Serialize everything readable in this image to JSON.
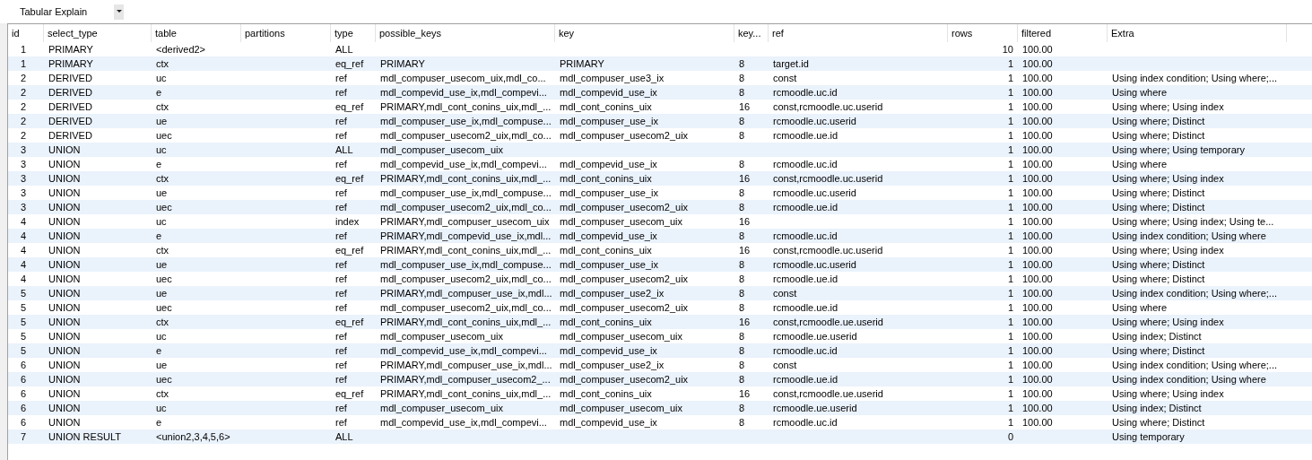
{
  "view_selector": {
    "value": "Tabular Explain"
  },
  "table": {
    "columns": [
      "id",
      "select_type",
      "table",
      "partitions",
      "type",
      "possible_keys",
      "key",
      "key...",
      "ref",
      "rows",
      "filtered",
      "Extra"
    ],
    "rows": [
      {
        "id": "1",
        "select_type": "PRIMARY",
        "table": "<derived2>",
        "type": "ALL",
        "rows": "10",
        "filtered": "100.00"
      },
      {
        "id": "1",
        "select_type": "PRIMARY",
        "table": "ctx",
        "type": "eq_ref",
        "possible_keys": "PRIMARY",
        "key": "PRIMARY",
        "key_len": "8",
        "ref": "target.id",
        "rows": "1",
        "filtered": "100.00"
      },
      {
        "id": "2",
        "select_type": "DERIVED",
        "table": "uc",
        "type": "ref",
        "possible_keys": "mdl_compuser_usecom_uix,mdl_co...",
        "key": "mdl_compuser_use3_ix",
        "key_len": "8",
        "ref": "const",
        "rows": "1",
        "filtered": "100.00",
        "extra": "Using index condition; Using where;..."
      },
      {
        "id": "2",
        "select_type": "DERIVED",
        "table": "e",
        "type": "ref",
        "possible_keys": "mdl_compevid_use_ix,mdl_compevi...",
        "key": "mdl_compevid_use_ix",
        "key_len": "8",
        "ref": "rcmoodle.uc.id",
        "rows": "1",
        "filtered": "100.00",
        "extra": "Using where"
      },
      {
        "id": "2",
        "select_type": "DERIVED",
        "table": "ctx",
        "type": "eq_ref",
        "possible_keys": "PRIMARY,mdl_cont_conins_uix,mdl_...",
        "key": "mdl_cont_conins_uix",
        "key_len": "16",
        "ref": "const,rcmoodle.uc.userid",
        "rows": "1",
        "filtered": "100.00",
        "extra": "Using where; Using index"
      },
      {
        "id": "2",
        "select_type": "DERIVED",
        "table": "ue",
        "type": "ref",
        "possible_keys": "mdl_compuser_use_ix,mdl_compuse...",
        "key": "mdl_compuser_use_ix",
        "key_len": "8",
        "ref": "rcmoodle.uc.userid",
        "rows": "1",
        "filtered": "100.00",
        "extra": "Using where; Distinct"
      },
      {
        "id": "2",
        "select_type": "DERIVED",
        "table": "uec",
        "type": "ref",
        "possible_keys": "mdl_compuser_usecom2_uix,mdl_co...",
        "key": "mdl_compuser_usecom2_uix",
        "key_len": "8",
        "ref": "rcmoodle.ue.id",
        "rows": "1",
        "filtered": "100.00",
        "extra": "Using where; Distinct"
      },
      {
        "id": "3",
        "select_type": "UNION",
        "table": "uc",
        "type": "ALL",
        "possible_keys": "mdl_compuser_usecom_uix",
        "rows": "1",
        "filtered": "100.00",
        "extra": "Using where; Using temporary"
      },
      {
        "id": "3",
        "select_type": "UNION",
        "table": "e",
        "type": "ref",
        "possible_keys": "mdl_compevid_use_ix,mdl_compevi...",
        "key": "mdl_compevid_use_ix",
        "key_len": "8",
        "ref": "rcmoodle.uc.id",
        "rows": "1",
        "filtered": "100.00",
        "extra": "Using where"
      },
      {
        "id": "3",
        "select_type": "UNION",
        "table": "ctx",
        "type": "eq_ref",
        "possible_keys": "PRIMARY,mdl_cont_conins_uix,mdl_...",
        "key": "mdl_cont_conins_uix",
        "key_len": "16",
        "ref": "const,rcmoodle.uc.userid",
        "rows": "1",
        "filtered": "100.00",
        "extra": "Using where; Using index"
      },
      {
        "id": "3",
        "select_type": "UNION",
        "table": "ue",
        "type": "ref",
        "possible_keys": "mdl_compuser_use_ix,mdl_compuse...",
        "key": "mdl_compuser_use_ix",
        "key_len": "8",
        "ref": "rcmoodle.uc.userid",
        "rows": "1",
        "filtered": "100.00",
        "extra": "Using where; Distinct"
      },
      {
        "id": "3",
        "select_type": "UNION",
        "table": "uec",
        "type": "ref",
        "possible_keys": "mdl_compuser_usecom2_uix,mdl_co...",
        "key": "mdl_compuser_usecom2_uix",
        "key_len": "8",
        "ref": "rcmoodle.ue.id",
        "rows": "1",
        "filtered": "100.00",
        "extra": "Using where; Distinct"
      },
      {
        "id": "4",
        "select_type": "UNION",
        "table": "uc",
        "type": "index",
        "possible_keys": "PRIMARY,mdl_compuser_usecom_uix",
        "key": "mdl_compuser_usecom_uix",
        "key_len": "16",
        "rows": "1",
        "filtered": "100.00",
        "extra": "Using where; Using index; Using te..."
      },
      {
        "id": "4",
        "select_type": "UNION",
        "table": "e",
        "type": "ref",
        "possible_keys": "PRIMARY,mdl_compevid_use_ix,mdl...",
        "key": "mdl_compevid_use_ix",
        "key_len": "8",
        "ref": "rcmoodle.uc.id",
        "rows": "1",
        "filtered": "100.00",
        "extra": "Using index condition; Using where"
      },
      {
        "id": "4",
        "select_type": "UNION",
        "table": "ctx",
        "type": "eq_ref",
        "possible_keys": "PRIMARY,mdl_cont_conins_uix,mdl_...",
        "key": "mdl_cont_conins_uix",
        "key_len": "16",
        "ref": "const,rcmoodle.uc.userid",
        "rows": "1",
        "filtered": "100.00",
        "extra": "Using where; Using index"
      },
      {
        "id": "4",
        "select_type": "UNION",
        "table": "ue",
        "type": "ref",
        "possible_keys": "mdl_compuser_use_ix,mdl_compuse...",
        "key": "mdl_compuser_use_ix",
        "key_len": "8",
        "ref": "rcmoodle.uc.userid",
        "rows": "1",
        "filtered": "100.00",
        "extra": "Using where; Distinct"
      },
      {
        "id": "4",
        "select_type": "UNION",
        "table": "uec",
        "type": "ref",
        "possible_keys": "mdl_compuser_usecom2_uix,mdl_co...",
        "key": "mdl_compuser_usecom2_uix",
        "key_len": "8",
        "ref": "rcmoodle.ue.id",
        "rows": "1",
        "filtered": "100.00",
        "extra": "Using where; Distinct"
      },
      {
        "id": "5",
        "select_type": "UNION",
        "table": "ue",
        "type": "ref",
        "possible_keys": "PRIMARY,mdl_compuser_use_ix,mdl...",
        "key": "mdl_compuser_use2_ix",
        "key_len": "8",
        "ref": "const",
        "rows": "1",
        "filtered": "100.00",
        "extra": "Using index condition; Using where;..."
      },
      {
        "id": "5",
        "select_type": "UNION",
        "table": "uec",
        "type": "ref",
        "possible_keys": "mdl_compuser_usecom2_uix,mdl_co...",
        "key": "mdl_compuser_usecom2_uix",
        "key_len": "8",
        "ref": "rcmoodle.ue.id",
        "rows": "1",
        "filtered": "100.00",
        "extra": "Using where"
      },
      {
        "id": "5",
        "select_type": "UNION",
        "table": "ctx",
        "type": "eq_ref",
        "possible_keys": "PRIMARY,mdl_cont_conins_uix,mdl_...",
        "key": "mdl_cont_conins_uix",
        "key_len": "16",
        "ref": "const,rcmoodle.ue.userid",
        "rows": "1",
        "filtered": "100.00",
        "extra": "Using where; Using index"
      },
      {
        "id": "5",
        "select_type": "UNION",
        "table": "uc",
        "type": "ref",
        "possible_keys": "mdl_compuser_usecom_uix",
        "key": "mdl_compuser_usecom_uix",
        "key_len": "8",
        "ref": "rcmoodle.ue.userid",
        "rows": "1",
        "filtered": "100.00",
        "extra": "Using index; Distinct"
      },
      {
        "id": "5",
        "select_type": "UNION",
        "table": "e",
        "type": "ref",
        "possible_keys": "mdl_compevid_use_ix,mdl_compevi...",
        "key": "mdl_compevid_use_ix",
        "key_len": "8",
        "ref": "rcmoodle.uc.id",
        "rows": "1",
        "filtered": "100.00",
        "extra": "Using where; Distinct"
      },
      {
        "id": "6",
        "select_type": "UNION",
        "table": "ue",
        "type": "ref",
        "possible_keys": "PRIMARY,mdl_compuser_use_ix,mdl...",
        "key": "mdl_compuser_use2_ix",
        "key_len": "8",
        "ref": "const",
        "rows": "1",
        "filtered": "100.00",
        "extra": "Using index condition; Using where;..."
      },
      {
        "id": "6",
        "select_type": "UNION",
        "table": "uec",
        "type": "ref",
        "possible_keys": "PRIMARY,mdl_compuser_usecom2_...",
        "key": "mdl_compuser_usecom2_uix",
        "key_len": "8",
        "ref": "rcmoodle.ue.id",
        "rows": "1",
        "filtered": "100.00",
        "extra": "Using index condition; Using where"
      },
      {
        "id": "6",
        "select_type": "UNION",
        "table": "ctx",
        "type": "eq_ref",
        "possible_keys": "PRIMARY,mdl_cont_conins_uix,mdl_...",
        "key": "mdl_cont_conins_uix",
        "key_len": "16",
        "ref": "const,rcmoodle.ue.userid",
        "rows": "1",
        "filtered": "100.00",
        "extra": "Using where; Using index"
      },
      {
        "id": "6",
        "select_type": "UNION",
        "table": "uc",
        "type": "ref",
        "possible_keys": "mdl_compuser_usecom_uix",
        "key": "mdl_compuser_usecom_uix",
        "key_len": "8",
        "ref": "rcmoodle.ue.userid",
        "rows": "1",
        "filtered": "100.00",
        "extra": "Using index; Distinct"
      },
      {
        "id": "6",
        "select_type": "UNION",
        "table": "e",
        "type": "ref",
        "possible_keys": "mdl_compevid_use_ix,mdl_compevi...",
        "key": "mdl_compevid_use_ix",
        "key_len": "8",
        "ref": "rcmoodle.uc.id",
        "rows": "1",
        "filtered": "100.00",
        "extra": "Using where; Distinct"
      },
      {
        "id": "7",
        "select_type": "UNION RESULT",
        "table": "<union2,3,4,5,6>",
        "type": "ALL",
        "rows": "0",
        "extra": "Using temporary"
      }
    ]
  }
}
